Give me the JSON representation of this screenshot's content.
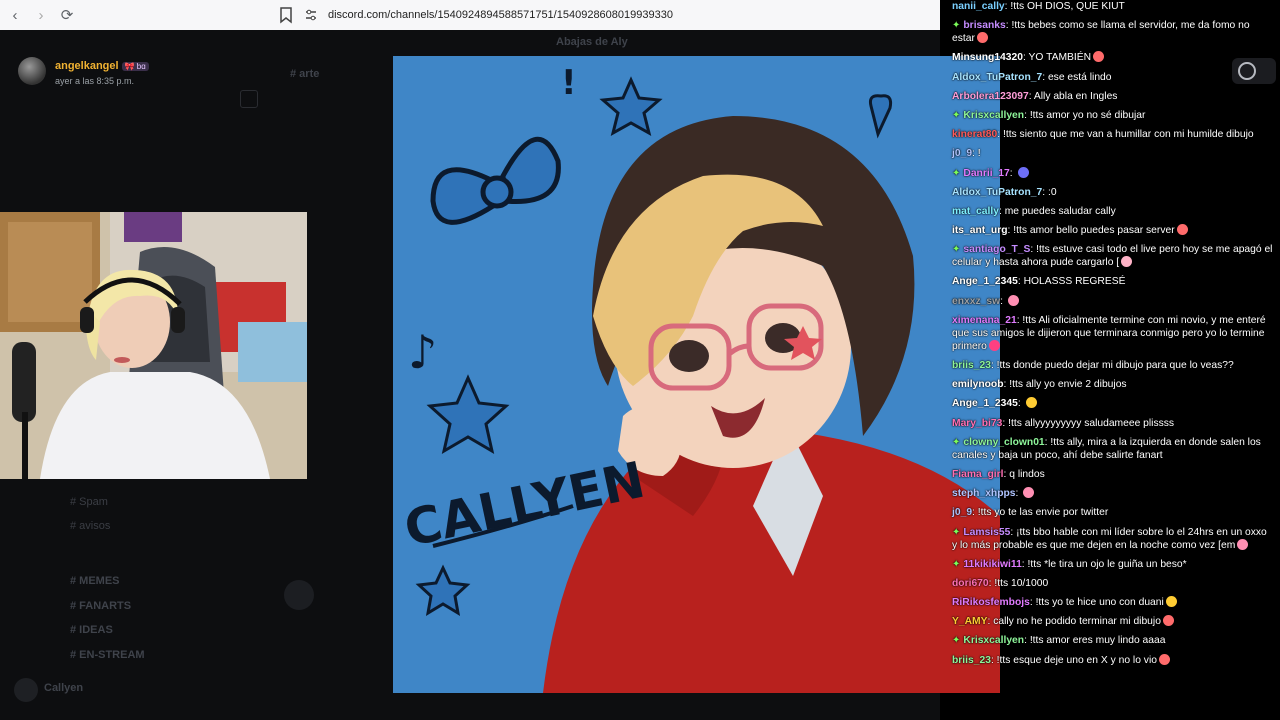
{
  "browser": {
    "url": "discord.com/channels/1540924894588571751/1540928608019939330",
    "back_icon": "arrow-left-icon",
    "forward_icon": "arrow-right-icon",
    "reload_icon": "reload-icon"
  },
  "discord": {
    "header_user": "angelkangel",
    "header_badge": "🎀 ƅɑ",
    "header_time": "ayer a las 8:35 p.m.",
    "ghost_channel_title": "Abajas de Aly",
    "ghost_channels": [
      "# arte",
      "# MEMES",
      "# FANARTS",
      "# IDEAS",
      "# EN-STREAM",
      "# Spam",
      "# avisos"
    ],
    "ghost_user": "Callyen"
  },
  "artwork": {
    "caption": "CALLYEN",
    "colors": {
      "bg": "#3f86c7",
      "hoodie": "#b8211e",
      "hair_blonde": "#e8c27a",
      "hair_dark": "#3a2a24"
    }
  },
  "chat": {
    "messages": [
      {
        "user": "nanii_cally",
        "color": "#7bd0ff",
        "text": "!tts OH DIOS, QUE KIUT",
        "sub": false
      },
      {
        "user": "brisanks",
        "color": "#c58cff",
        "text": "!tts bebes como se llama el servidor, me da fomo no estar",
        "sub": true,
        "emote": "#ff6b6b"
      },
      {
        "user": "Minsung14320",
        "color": "#ffffff",
        "text": "YO TAMBIÉN",
        "sub": false,
        "emote": "#ff6b6b"
      },
      {
        "user": "Aldox_TuPatron_7",
        "color": "#a7e3ff",
        "text": "ese está lindo",
        "sub": false
      },
      {
        "user": "Arbolera123097",
        "color": "#ff9dd9",
        "text": "Ally abla en Ingles",
        "sub": false
      },
      {
        "user": "Krisxcallyen",
        "color": "#8ef59a",
        "text": "!tts amor yo no sé dibujar",
        "sub": true
      },
      {
        "user": "kinerat80",
        "color": "#ff5b5b",
        "text": "!tts siento que me van a humillar con mi humilde dibujo",
        "sub": false
      },
      {
        "user": "j0_9",
        "color": "#b0c4ff",
        "text": "!",
        "sub": false
      },
      {
        "user": "Danrii_17",
        "color": "#e07bff",
        "text": "",
        "sub": true,
        "emote": "#6d6ef7"
      },
      {
        "user": "Aldox_TuPatron_7",
        "color": "#a7e3ff",
        "text": ":0",
        "sub": false
      },
      {
        "user": "mat_cally",
        "color": "#7ef0ff",
        "text": "me puedes saludar cally",
        "sub": false
      },
      {
        "user": "its_ant_urg",
        "color": "#ffffff",
        "text": "!tts amor bello puedes pasar server",
        "sub": false,
        "emote": "#ff6b6b"
      },
      {
        "user": "santiago_T_S",
        "color": "#c58cff",
        "text": "!tts estuve casi todo el live pero hoy se me apagó el celular y hasta ahora pude cargarlo [",
        "sub": true,
        "emote": "#ffb3c7"
      },
      {
        "user": "Ange_1_2345",
        "color": "#ffffff",
        "text": "HOLASSS REGRESÉ",
        "sub": false
      },
      {
        "user": "enxxz_sw",
        "color": "#9aa0a6",
        "text": "",
        "sub": false,
        "emote": "#ff8fb3"
      },
      {
        "user": "ximenana_21",
        "color": "#e07bff",
        "text": "!tts Ali oficialmente termine con mi novio, y me enteré que sus amigos le dijieron que terminara conmigo pero yo lo termine primero",
        "sub": false,
        "emote": "#ff4081"
      },
      {
        "user": "briis_23",
        "color": "#8ef59a",
        "text": "!tts donde puedo dejar mi dibujo para que lo veas??",
        "sub": false
      },
      {
        "user": "emilynoob",
        "color": "#ffffff",
        "text": "!tts ally yo envie 2 dibujos",
        "sub": false
      },
      {
        "user": "Ange_1_2345",
        "color": "#ffffff",
        "text": "",
        "sub": false,
        "emote": "#ffcc33"
      },
      {
        "user": "Mary_bi73",
        "color": "#ff6fb3",
        "text": "!tts allyyyyyyyyy saludameee plissss",
        "sub": false
      },
      {
        "user": "clowny_clown01",
        "color": "#8ef59a",
        "text": "!tts ally, mira a la izquierda en donde salen los canales y baja un poco, ahí debe salirte fanart",
        "sub": true
      },
      {
        "user": "Fiama_girl",
        "color": "#ff6fb3",
        "text": "q lindos",
        "sub": false
      },
      {
        "user": "steph_xhpps",
        "color": "#b0c4ff",
        "text": "",
        "sub": false,
        "emote": "#ff8fb3"
      },
      {
        "user": "j0_9",
        "color": "#b0c4ff",
        "text": "!tts yo te las envie por twitter",
        "sub": false
      },
      {
        "user": "Lamsis55",
        "color": "#c58cff",
        "text": "¡tts bbo hable con mi líder sobre lo el 24hrs en un oxxo y lo más probable es que me dejen en la noche como vez [em",
        "sub": true,
        "emote": "#ff8fb3"
      },
      {
        "user": "11kikikiwi11",
        "color": "#e07bff",
        "text": "!tts *le tira un ojo le guiña un beso*",
        "sub": true
      },
      {
        "user": "dori670",
        "color": "#ff6fb3",
        "text": "!tts 10/1000",
        "sub": false
      },
      {
        "user": "RiRikosfembojs",
        "color": "#e07bff",
        "text": "!tts yo te hice uno con duani",
        "sub": false,
        "emote": "#ffcc33"
      },
      {
        "user": "Y_AMY",
        "color": "#ffcc33",
        "text": "cally no he podido terminar mi dibujo",
        "sub": false,
        "emote": "#ff6b6b"
      },
      {
        "user": "Krisxcallyen",
        "color": "#8ef59a",
        "text": "!tts amor eres muy lindo aaaa",
        "sub": true
      },
      {
        "user": "briis_23",
        "color": "#8ef59a",
        "text": "!tts esque deje uno en X y no lo vio",
        "sub": false,
        "emote": "#ff6b6b"
      }
    ]
  }
}
